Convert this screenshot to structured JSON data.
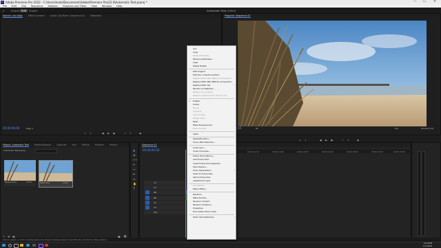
{
  "window": {
    "title": "Adobe Premiere Pro 2022 - C:\\Users\\tsoto\\Documents\\Adobe\\Premiere Pro\\22.0\\Automatic Test.prproj *",
    "minimize": "—",
    "maximize": "☐",
    "close": "✕"
  },
  "menu": [
    "File",
    "Edit",
    "Clip",
    "Sequence",
    "Markers",
    "Graphics and Titles",
    "View",
    "Window",
    "Help"
  ],
  "workspace": {
    "tabs": [
      "Import",
      "Edit",
      "Export"
    ],
    "active": "Edit",
    "center_title": "Automatic Test",
    "center_sub": "Edited"
  },
  "source_panel": {
    "tabs": [
      "Source: (no clips)",
      "Effect Controls",
      "Audio Clip Mixer: Sequence 01",
      "Metadata"
    ],
    "timecode_left": "00;00;00;00",
    "page": "Page 1",
    "timecode_right": "00;00;00;00"
  },
  "program_panel": {
    "tab": "Program: Sequence 01",
    "timecode_left": "00;00;00;00",
    "fit": "Fit",
    "fraction": "Full",
    "timecode_right": "00;00;11;10"
  },
  "project_panel": {
    "tabs": [
      "Project: Automatic Test",
      "Media Browser",
      "Libraries",
      "Info",
      "Effects",
      "Markers",
      "History"
    ],
    "file": "Automatic Test.prproj",
    "clips": [
      {
        "name": "Sequence 01",
        "duration": "11;10"
      },
      {
        "name": "beach.mov",
        "duration": "11;10"
      }
    ]
  },
  "timeline": {
    "tab": "Sequence 01",
    "timecode": "00;00;00;00",
    "ruler": [
      "00;00",
      "00;00;04;00",
      "00;00;08;00",
      "00;00;12;00",
      "00;00;16;00",
      "00;00;20;00",
      "00;00;24;00",
      "00;00;28;00",
      "00;00;32;00",
      "00;00;36;00"
    ],
    "tracks": [
      "V3",
      "V2",
      "V1",
      "A1",
      "A2",
      "A3",
      "Mix"
    ]
  },
  "status_text": "Click to select, or click in empty space and drag to marquee select. Use Shift, Alt, and Ctrl for other options.",
  "context_menu": {
    "items": [
      {
        "label": "Cut",
        "enabled": true
      },
      {
        "label": "Copy",
        "enabled": true
      },
      {
        "label": "Paste Attributes...",
        "enabled": false
      },
      {
        "label": "Remove Attributes...",
        "enabled": true
      },
      {
        "label": "Clear",
        "enabled": true
      },
      {
        "label": "Ripple Delete",
        "enabled": true
      },
      {
        "sep": true
      },
      {
        "label": "Edit Original",
        "enabled": true
      },
      {
        "label": "Edit Clip in Adobe Audition",
        "enabled": true
      },
      {
        "label": "Replace With After Effects Composition",
        "enabled": false
      },
      {
        "label": "Replace With After Effects Composition",
        "enabled": true
      },
      {
        "label": "Replace With Clip",
        "enabled": true,
        "submenu": true
      },
      {
        "label": "Render and Replace...",
        "enabled": true
      },
      {
        "label": "Restore Unrendered",
        "enabled": false
      },
      {
        "label": "Restore Captions from Source Clip",
        "enabled": false
      },
      {
        "sep": true
      },
      {
        "label": "Enable",
        "enabled": true,
        "checked": true
      },
      {
        "label": "Unlink",
        "enabled": true
      },
      {
        "label": "Group",
        "enabled": false
      },
      {
        "label": "Ungroup",
        "enabled": false
      },
      {
        "label": "Synchronize",
        "enabled": false
      },
      {
        "label": "Merge Clips...",
        "enabled": false
      },
      {
        "label": "Nest...",
        "enabled": true
      },
      {
        "label": "Make Subsequence",
        "enabled": true
      },
      {
        "label": "Multi-Camera",
        "enabled": false
      },
      {
        "sep": true
      },
      {
        "label": "Label",
        "enabled": true,
        "submenu": true
      },
      {
        "sep": true
      },
      {
        "label": "Speed/Duration...",
        "enabled": true
      },
      {
        "label": "Scene Edit Detection...",
        "enabled": true
      },
      {
        "sep": true
      },
      {
        "label": "Audio Gain...",
        "enabled": true
      },
      {
        "label": "Audio Channels...",
        "enabled": true
      },
      {
        "sep": true
      },
      {
        "label": "Frame Hold Options...",
        "enabled": true
      },
      {
        "label": "Add Frame Hold",
        "enabled": true
      },
      {
        "label": "Insert Frame Hold Segment",
        "enabled": true
      },
      {
        "label": "Field Options...",
        "enabled": true
      },
      {
        "label": "Time Interpolation",
        "enabled": true,
        "submenu": true
      },
      {
        "label": "Scale to Frame Size",
        "enabled": true
      },
      {
        "label": "Set to Frame Size",
        "enabled": true
      },
      {
        "label": "Adjustment Layer",
        "enabled": true
      },
      {
        "sep": true
      },
      {
        "label": "Link Media...",
        "enabled": false
      },
      {
        "label": "Make Offline...",
        "enabled": true
      },
      {
        "sep": true
      },
      {
        "label": "Rename...",
        "enabled": true
      },
      {
        "label": "Make Subclip...",
        "enabled": true
      },
      {
        "label": "Reveal in Project",
        "enabled": true
      },
      {
        "label": "Reveal in Explorer...",
        "enabled": true
      },
      {
        "label": "Properties",
        "enabled": true
      },
      {
        "label": "Find Adobe Stock Audio",
        "enabled": true
      },
      {
        "sep": true
      },
      {
        "label": "Show Clip Keyframes",
        "enabled": true,
        "submenu": true
      }
    ]
  },
  "taskbar": {
    "time": "10:26 PM",
    "date": "1/11/2022",
    "apps": [
      "windows",
      "search",
      "file-explorer",
      "edge",
      "premiere",
      "chrome"
    ]
  },
  "colors": {
    "accent": "#4f8ff7",
    "clip_video": "#4a6fb8",
    "clip_audio": "#3a7a3a"
  }
}
